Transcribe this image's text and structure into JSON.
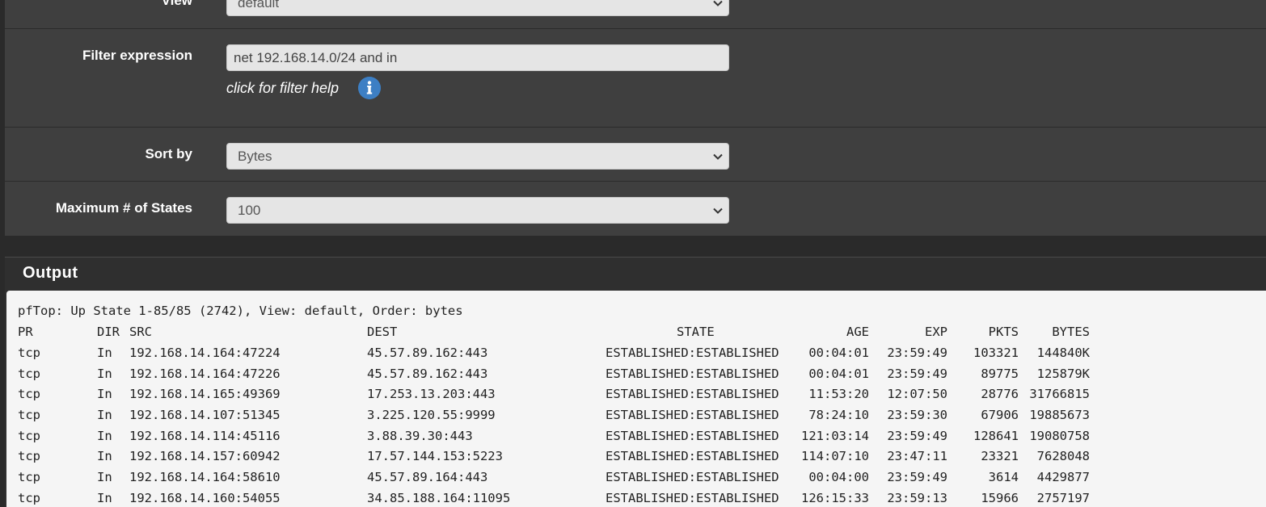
{
  "form": {
    "view": {
      "label": "View",
      "value": "default"
    },
    "filter": {
      "label": "Filter expression",
      "value": "net 192.168.14.0/24 and in",
      "help": "click for filter help"
    },
    "sort": {
      "label": "Sort by",
      "value": "Bytes"
    },
    "max_states": {
      "label": "Maximum # of States",
      "value": "100"
    }
  },
  "output": {
    "title": "Output",
    "summary": "pfTop: Up State 1-85/85 (2742), View: default, Order: bytes",
    "columns": {
      "pr": "PR",
      "dir": "DIR",
      "src": "SRC",
      "dest": "DEST",
      "state": "STATE",
      "age": "AGE",
      "exp": "EXP",
      "pkts": "PKTS",
      "bytes": "BYTES"
    },
    "rows": [
      {
        "pr": "tcp",
        "dir": "In",
        "src": "192.168.14.164:47224",
        "dest": "45.57.89.162:443",
        "state": "ESTABLISHED:ESTABLISHED",
        "age": "00:04:01",
        "exp": "23:59:49",
        "pkts": "103321",
        "bytes": "144840K"
      },
      {
        "pr": "tcp",
        "dir": "In",
        "src": "192.168.14.164:47226",
        "dest": "45.57.89.162:443",
        "state": "ESTABLISHED:ESTABLISHED",
        "age": "00:04:01",
        "exp": "23:59:49",
        "pkts": "89775",
        "bytes": "125879K"
      },
      {
        "pr": "tcp",
        "dir": "In",
        "src": "192.168.14.165:49369",
        "dest": "17.253.13.203:443",
        "state": "ESTABLISHED:ESTABLISHED",
        "age": "11:53:20",
        "exp": "12:07:50",
        "pkts": "28776",
        "bytes": "31766815"
      },
      {
        "pr": "tcp",
        "dir": "In",
        "src": "192.168.14.107:51345",
        "dest": "3.225.120.55:9999",
        "state": "ESTABLISHED:ESTABLISHED",
        "age": "78:24:10",
        "exp": "23:59:30",
        "pkts": "67906",
        "bytes": "19885673"
      },
      {
        "pr": "tcp",
        "dir": "In",
        "src": "192.168.14.114:45116",
        "dest": "3.88.39.30:443",
        "state": "ESTABLISHED:ESTABLISHED",
        "age": "121:03:14",
        "exp": "23:59:49",
        "pkts": "128641",
        "bytes": "19080758"
      },
      {
        "pr": "tcp",
        "dir": "In",
        "src": "192.168.14.157:60942",
        "dest": "17.57.144.153:5223",
        "state": "ESTABLISHED:ESTABLISHED",
        "age": "114:07:10",
        "exp": "23:47:11",
        "pkts": "23321",
        "bytes": "7628048"
      },
      {
        "pr": "tcp",
        "dir": "In",
        "src": "192.168.14.164:58610",
        "dest": "45.57.89.164:443",
        "state": "ESTABLISHED:ESTABLISHED",
        "age": "00:04:00",
        "exp": "23:59:49",
        "pkts": "3614",
        "bytes": "4429877"
      },
      {
        "pr": "tcp",
        "dir": "In",
        "src": "192.168.14.160:54055",
        "dest": "34.85.188.164:11095",
        "state": "ESTABLISHED:ESTABLISHED",
        "age": "126:15:33",
        "exp": "23:59:13",
        "pkts": "15966",
        "bytes": "2757197"
      }
    ]
  },
  "icons": {
    "chevron": "chevron-down-icon",
    "info": "info-icon"
  },
  "colors": {
    "panel": "#3f3f3f",
    "info_blue": "#3d7fc4",
    "output_bg": "#f5f5f5"
  }
}
